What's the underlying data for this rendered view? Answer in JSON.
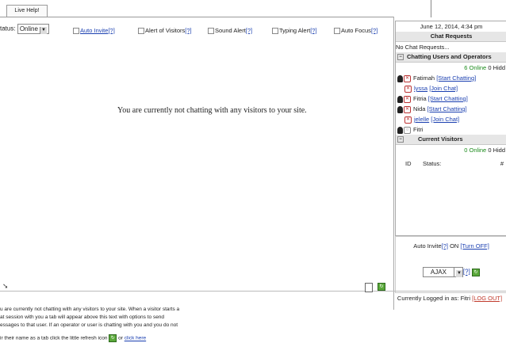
{
  "tab": {
    "label": "Live Help!"
  },
  "status": {
    "label": "tatus:",
    "value": "Online"
  },
  "options": [
    {
      "label": "Auto Invite",
      "help": "[?]",
      "link": true
    },
    {
      "label": "Alert of Visitors",
      "help": "[?]",
      "link": false
    },
    {
      "label": "Sound Alert",
      "help": "[?]",
      "link": false
    },
    {
      "label": "Typing Alert",
      "help": "[?]",
      "link": false
    },
    {
      "label": "Auto Focus",
      "help": "[?]",
      "link": false
    }
  ],
  "main": {
    "message": "You are currently not chatting with any visitors to your site."
  },
  "sidebar": {
    "datetime": "June 12, 2014, 4:34 pm",
    "chat_requests": {
      "title": "Chat Requests",
      "empty": "No Chat Requests..."
    },
    "users": {
      "title": "Chatting Users and Operators",
      "online_count": "6 Online",
      "hidden": "0 Hidd",
      "items": [
        {
          "name": "Fatimah",
          "action": "[Start Chatting]",
          "type": "operator"
        },
        {
          "name": "lyssa",
          "action": "[Join Chat]",
          "type": "user"
        },
        {
          "name": "Fitria",
          "action": "[Start Chatting]",
          "type": "operator"
        },
        {
          "name": "Nida",
          "action": "[Start Chatting]",
          "type": "operator"
        },
        {
          "name": "jelelle",
          "action": "[Join Chat]",
          "type": "user"
        },
        {
          "name": "Fitri",
          "action": "",
          "type": "self"
        }
      ]
    },
    "visitors": {
      "title": "Current Visitors",
      "online_count": "0 Online",
      "hidden": "0 Hidd",
      "col_id": "ID",
      "col_status": "Status:",
      "col_hash": "#"
    },
    "autoinvite": {
      "label": "Auto Invite",
      "help": "[?]",
      "state": "ON",
      "toggle": "[Turn OFF]"
    },
    "mode": {
      "value": "AJAX",
      "help": "[?]"
    },
    "logged": {
      "label": "Currently Logged in as:",
      "user": "Fitri",
      "logout": "[LOG OUT]"
    }
  },
  "bottom": {
    "line1": "u are currently not chatting with any visitors to your site. When a visitor starts a",
    "line2": "at session with you a tab will appear above this text with options to send",
    "line3": "essages to that user. If an operator or user is chatting with you and you do not",
    "line4": "ir their name as a tab click the little refresh icon",
    "or": "or",
    "click_here": "click here"
  }
}
